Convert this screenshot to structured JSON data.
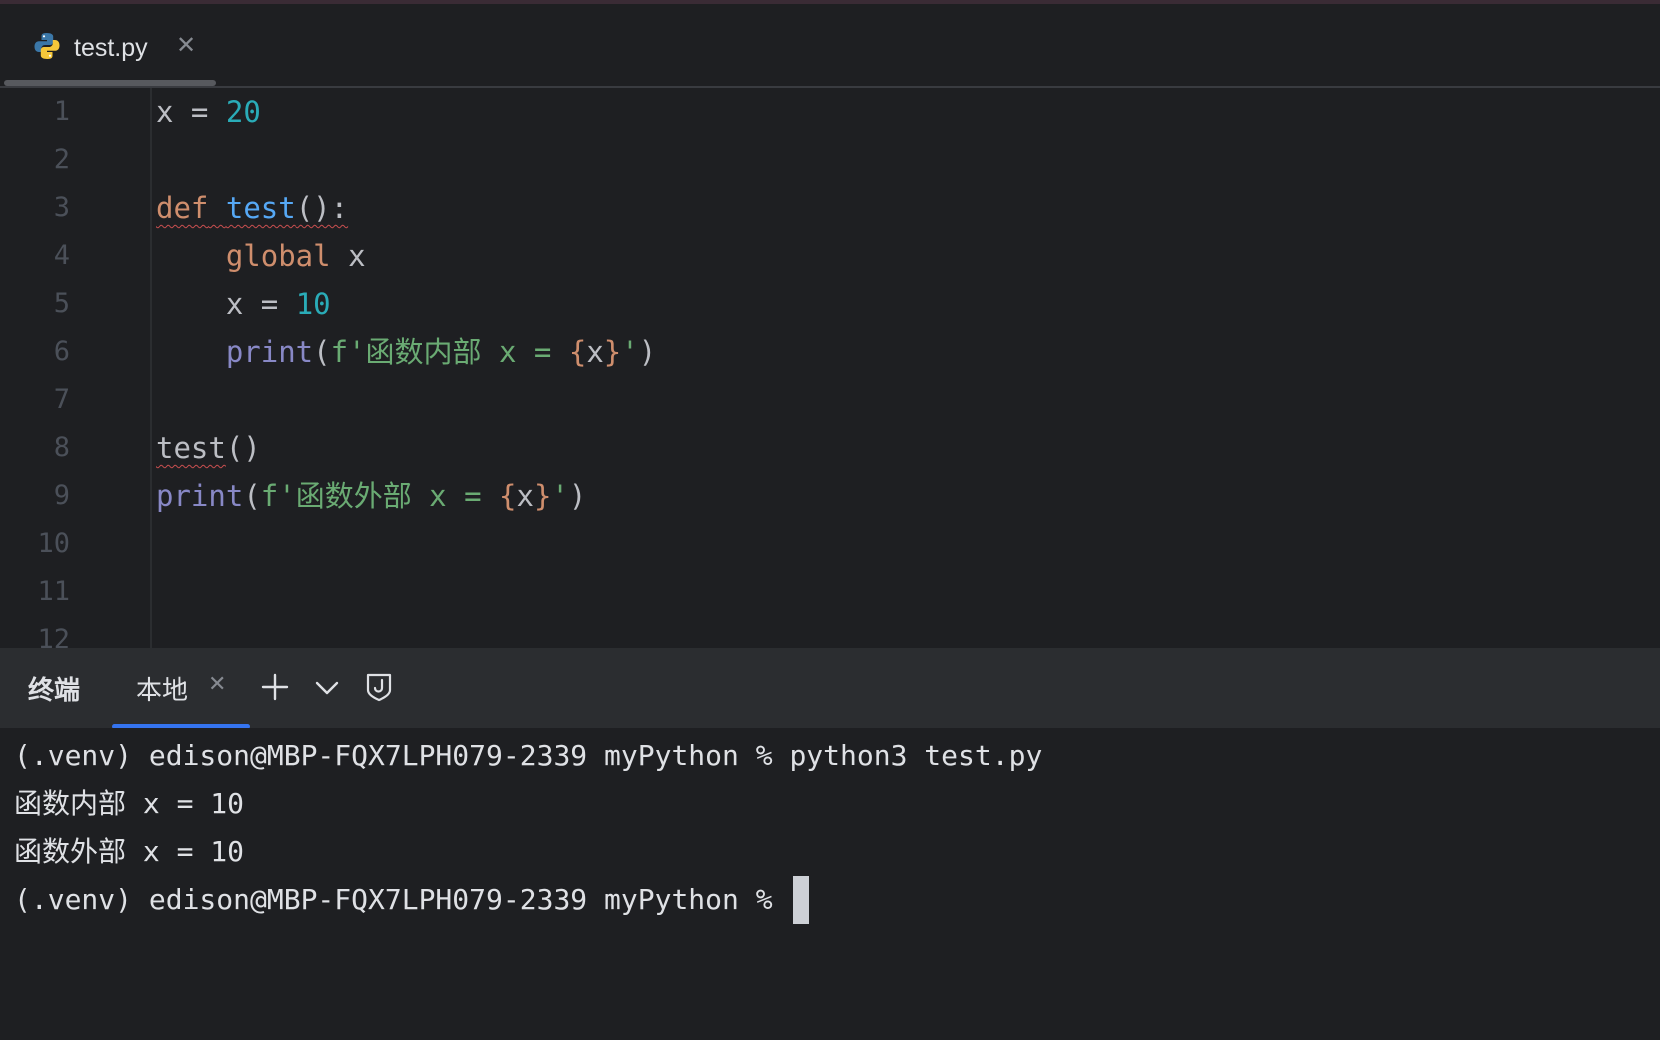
{
  "tab": {
    "filename": "test.py"
  },
  "editor": {
    "line_numbers": [
      "1",
      "2",
      "3",
      "4",
      "5",
      "6",
      "7",
      "8",
      "9",
      "10",
      "11",
      "12"
    ],
    "code": {
      "l1_var": "x",
      "l1_eq": " = ",
      "l1_num": "20",
      "l3_def": "def",
      "l3_name": "test",
      "l3_tail": "():",
      "l4_global": "global",
      "l4_var": " x",
      "l5_var": "x",
      "l5_eq": " = ",
      "l5_num": "10",
      "l6_print": "print",
      "l6_open": "(",
      "l6_str1": "f'函数内部 x = ",
      "l6_lb": "{",
      "l6_x": "x",
      "l6_rb": "}",
      "l6_str2": "'",
      "l6_close": ")",
      "l8_call": "test",
      "l8_paren": "()",
      "l9_print": "print",
      "l9_open": "(",
      "l9_str1": "f'函数外部 x = ",
      "l9_lb": "{",
      "l9_x": "x",
      "l9_rb": "}",
      "l9_str2": "'",
      "l9_close": ")"
    }
  },
  "terminal_panel": {
    "title": "终端",
    "tab_label": "本地",
    "lines": [
      "(.venv) edison@MBP-FQX7LPH079-2339 myPython % python3 test.py",
      "函数内部 x = 10",
      "函数外部 x = 10",
      "(.venv) edison@MBP-FQX7LPH079-2339 myPython % "
    ]
  },
  "icons": [
    "python-file-icon",
    "close-icon",
    "add-icon",
    "chevron-down-icon",
    "shield-icon"
  ]
}
